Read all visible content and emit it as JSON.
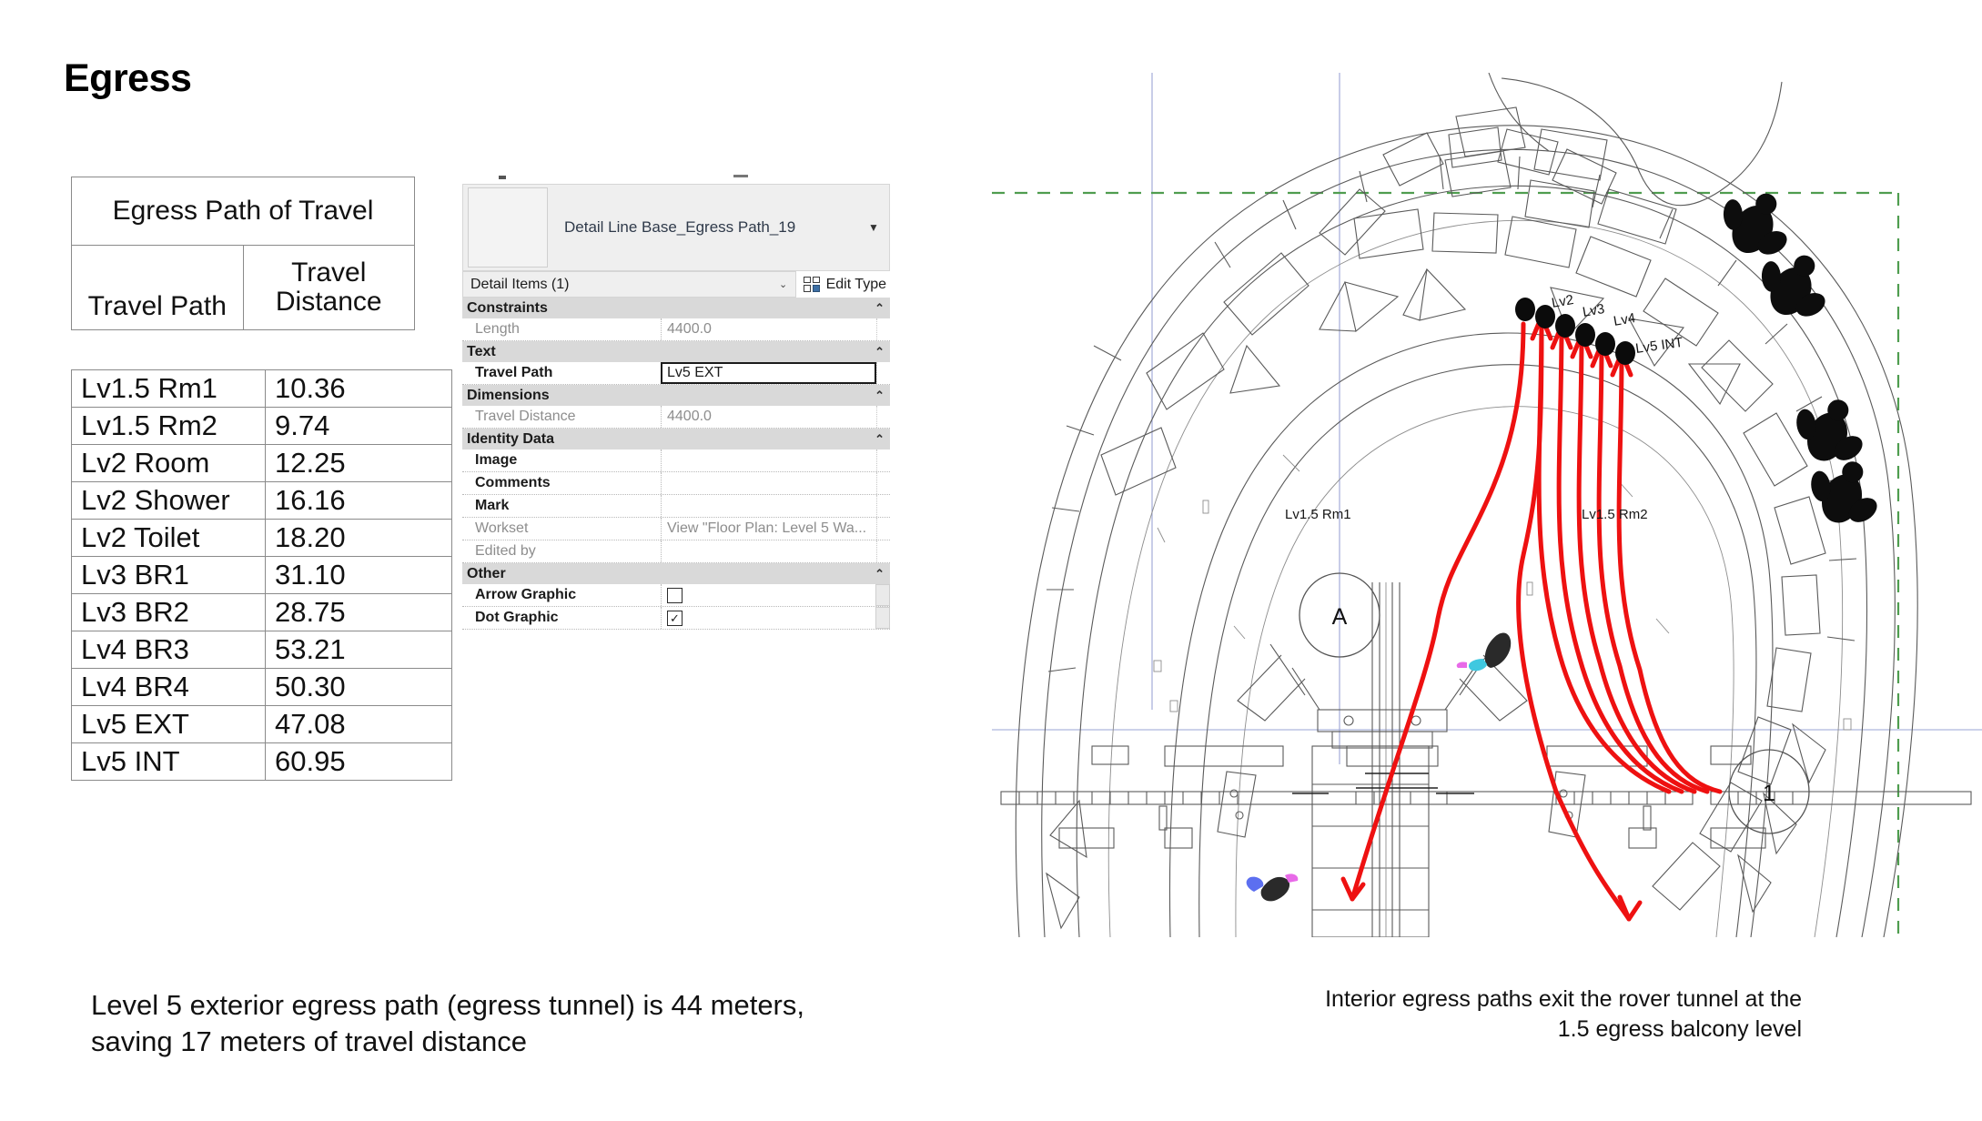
{
  "slide": {
    "title": "Egress"
  },
  "egress_table": {
    "title": "Egress Path of Travel",
    "columns": [
      "Travel Path",
      "Travel Distance"
    ],
    "column_lines": [
      [
        "Travel",
        "Path"
      ],
      [
        "Travel",
        "Distance"
      ]
    ],
    "rows": [
      {
        "path": "Lv1.5 Rm1",
        "distance": "10.36"
      },
      {
        "path": "Lv1.5 Rm2",
        "distance": "9.74"
      },
      {
        "path": "Lv2 Room",
        "distance": "12.25"
      },
      {
        "path": "Lv2 Shower",
        "distance": "16.16"
      },
      {
        "path": "Lv2 Toilet",
        "distance": "18.20"
      },
      {
        "path": "Lv3 BR1",
        "distance": "31.10"
      },
      {
        "path": "Lv3 BR2",
        "distance": "28.75"
      },
      {
        "path": "Lv4 BR3",
        "distance": "53.21"
      },
      {
        "path": "Lv4 BR4",
        "distance": "50.30"
      },
      {
        "path": "Lv5 EXT",
        "distance": "47.08"
      },
      {
        "path": "Lv5 INT",
        "distance": "60.95"
      }
    ]
  },
  "properties_panel": {
    "type_name": "Detail Line Base_Egress Path_19",
    "type_dropdown_arrow": "▼",
    "category": "Detail Items (1)",
    "category_arrow": "⌄",
    "edit_type_label": "Edit Type",
    "collapse_chevron": "⌃",
    "sections": [
      {
        "name": "Constraints",
        "rows": [
          {
            "label": "Length",
            "value": "4400.0",
            "dimmed": true,
            "grip": true
          }
        ]
      },
      {
        "name": "Text",
        "rows": [
          {
            "label": "Travel Path",
            "value": "Lv5 EXT",
            "dimmed": false,
            "focused": true,
            "grip": true
          }
        ]
      },
      {
        "name": "Dimensions",
        "rows": [
          {
            "label": "Travel Distance",
            "value": "4400.0",
            "dimmed": true,
            "grip": true
          }
        ]
      },
      {
        "name": "Identity Data",
        "rows": [
          {
            "label": "Image",
            "value": "",
            "dimmed": false,
            "grip": true
          },
          {
            "label": "Comments",
            "value": "",
            "dimmed": false,
            "grip": true
          },
          {
            "label": "Mark",
            "value": "",
            "dimmed": false,
            "grip": true
          },
          {
            "label": "Workset",
            "value": "View \"Floor Plan: Level 5 Wa...",
            "dimmed": true,
            "grip": true
          },
          {
            "label": "Edited by",
            "value": "",
            "dimmed": true,
            "grip": true
          }
        ]
      },
      {
        "name": "Other",
        "rows": [
          {
            "label": "Arrow Graphic",
            "checkbox": true,
            "checked": false,
            "grip_filled": true
          },
          {
            "label": "Dot Graphic",
            "checkbox": true,
            "checked": true,
            "grip_filled": true
          }
        ]
      }
    ],
    "checkbox_check_glyph": "✓"
  },
  "cad": {
    "grid_bubbles": [
      {
        "label": "A"
      },
      {
        "label": "1"
      }
    ],
    "path_labels": [
      "Lv2",
      "Lv3",
      "Lv4",
      "Lv5 INT"
    ],
    "room_labels": [
      "Lv1.5 Rm1",
      "Lv1.5 Rm2"
    ],
    "colors": {
      "egress_path": "#ee1111",
      "property_line": "#4f9d4f",
      "grid": "#9aa4d4",
      "linework": "#5a5a5a"
    }
  },
  "captions": {
    "left": "Level 5 exterior egress path (egress tunnel) is 44 meters, saving 17 meters of travel distance",
    "right_line1": "Interior egress paths exit the rover tunnel at the",
    "right_line2": "1.5 egress balcony level"
  }
}
